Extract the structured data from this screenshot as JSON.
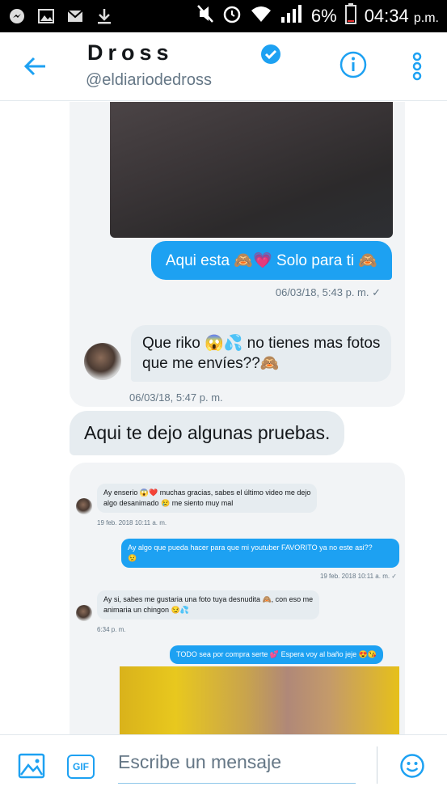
{
  "status_bar": {
    "battery": "6%",
    "time": "04:34",
    "time_suffix": "p.m.",
    "icons_left": [
      "messenger-icon",
      "gallery-icon",
      "mail-icon",
      "download-icon"
    ],
    "icons_right": [
      "mute-icon",
      "alarm-icon",
      "wifi-icon",
      "signal-icon",
      "battery-icon"
    ]
  },
  "header": {
    "name": "Dross",
    "handle": "@eldiariodedross",
    "verified": true,
    "accent": "#1da1f2"
  },
  "screenshot1": {
    "outgoing": "Aqui esta 🙈💗 Solo para ti 🙈",
    "outgoing_time": "06/03/18, 5:43 p. m. ✓",
    "incoming_line1": "Que riko 😱💦 no tienes mas fotos",
    "incoming_line2": "que me envíes??🙈",
    "incoming_time": "06/03/18, 5:47 p. m."
  },
  "message": {
    "text": "Aqui te dejo algunas pruebas."
  },
  "screenshot2": {
    "m1_line1": "Ay enserio 😱❤️ muchas gracias, sabes el último video me dejo",
    "m1_line2": "algo desanimado 😢 me siento muy mal",
    "m1_time": "19 feb. 2018 10:11 a. m.",
    "m2_line1": "Ay algo que pueda hacer para que mi youtuber FAVORITO ya no este asi??",
    "m2_line2": "😟",
    "m2_time": "19 feb. 2018 10:11 a. m. ✓",
    "m3_line1": "Ay si, sabes me gustaria una foto tuya desnudita 🙈, con eso me",
    "m3_line2": "animaria un chingon 😏💦",
    "m3_time": "6:34 p. m.",
    "m4": "TODO sea por compra serte 💕 Espera voy al baño jeje 😍😘"
  },
  "composer": {
    "placeholder": "Escribe un mensaje",
    "gif_label": "GIF"
  }
}
